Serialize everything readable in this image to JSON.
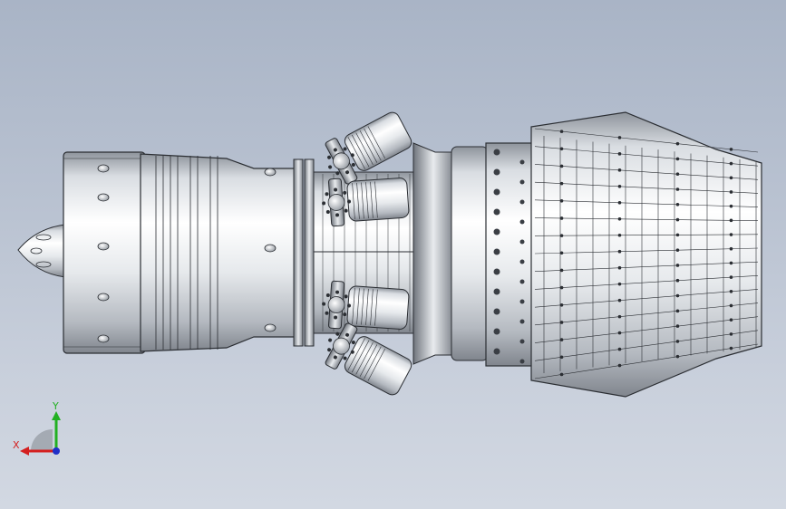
{
  "viewport": {
    "model_name": "jet-engine-assembly",
    "colors": {
      "bg_top": "#a9b4c6",
      "bg_bottom": "#d2d8e2",
      "metal_light": "#f2f4f6",
      "metal_mid": "#c8cdd3",
      "metal_dark": "#7b8088",
      "edge": "#2b2e33"
    }
  },
  "triad": {
    "x_label": "X",
    "y_label": "Y",
    "x_color": "#d42020",
    "y_color": "#22b022",
    "z_color": "#2030c8"
  }
}
